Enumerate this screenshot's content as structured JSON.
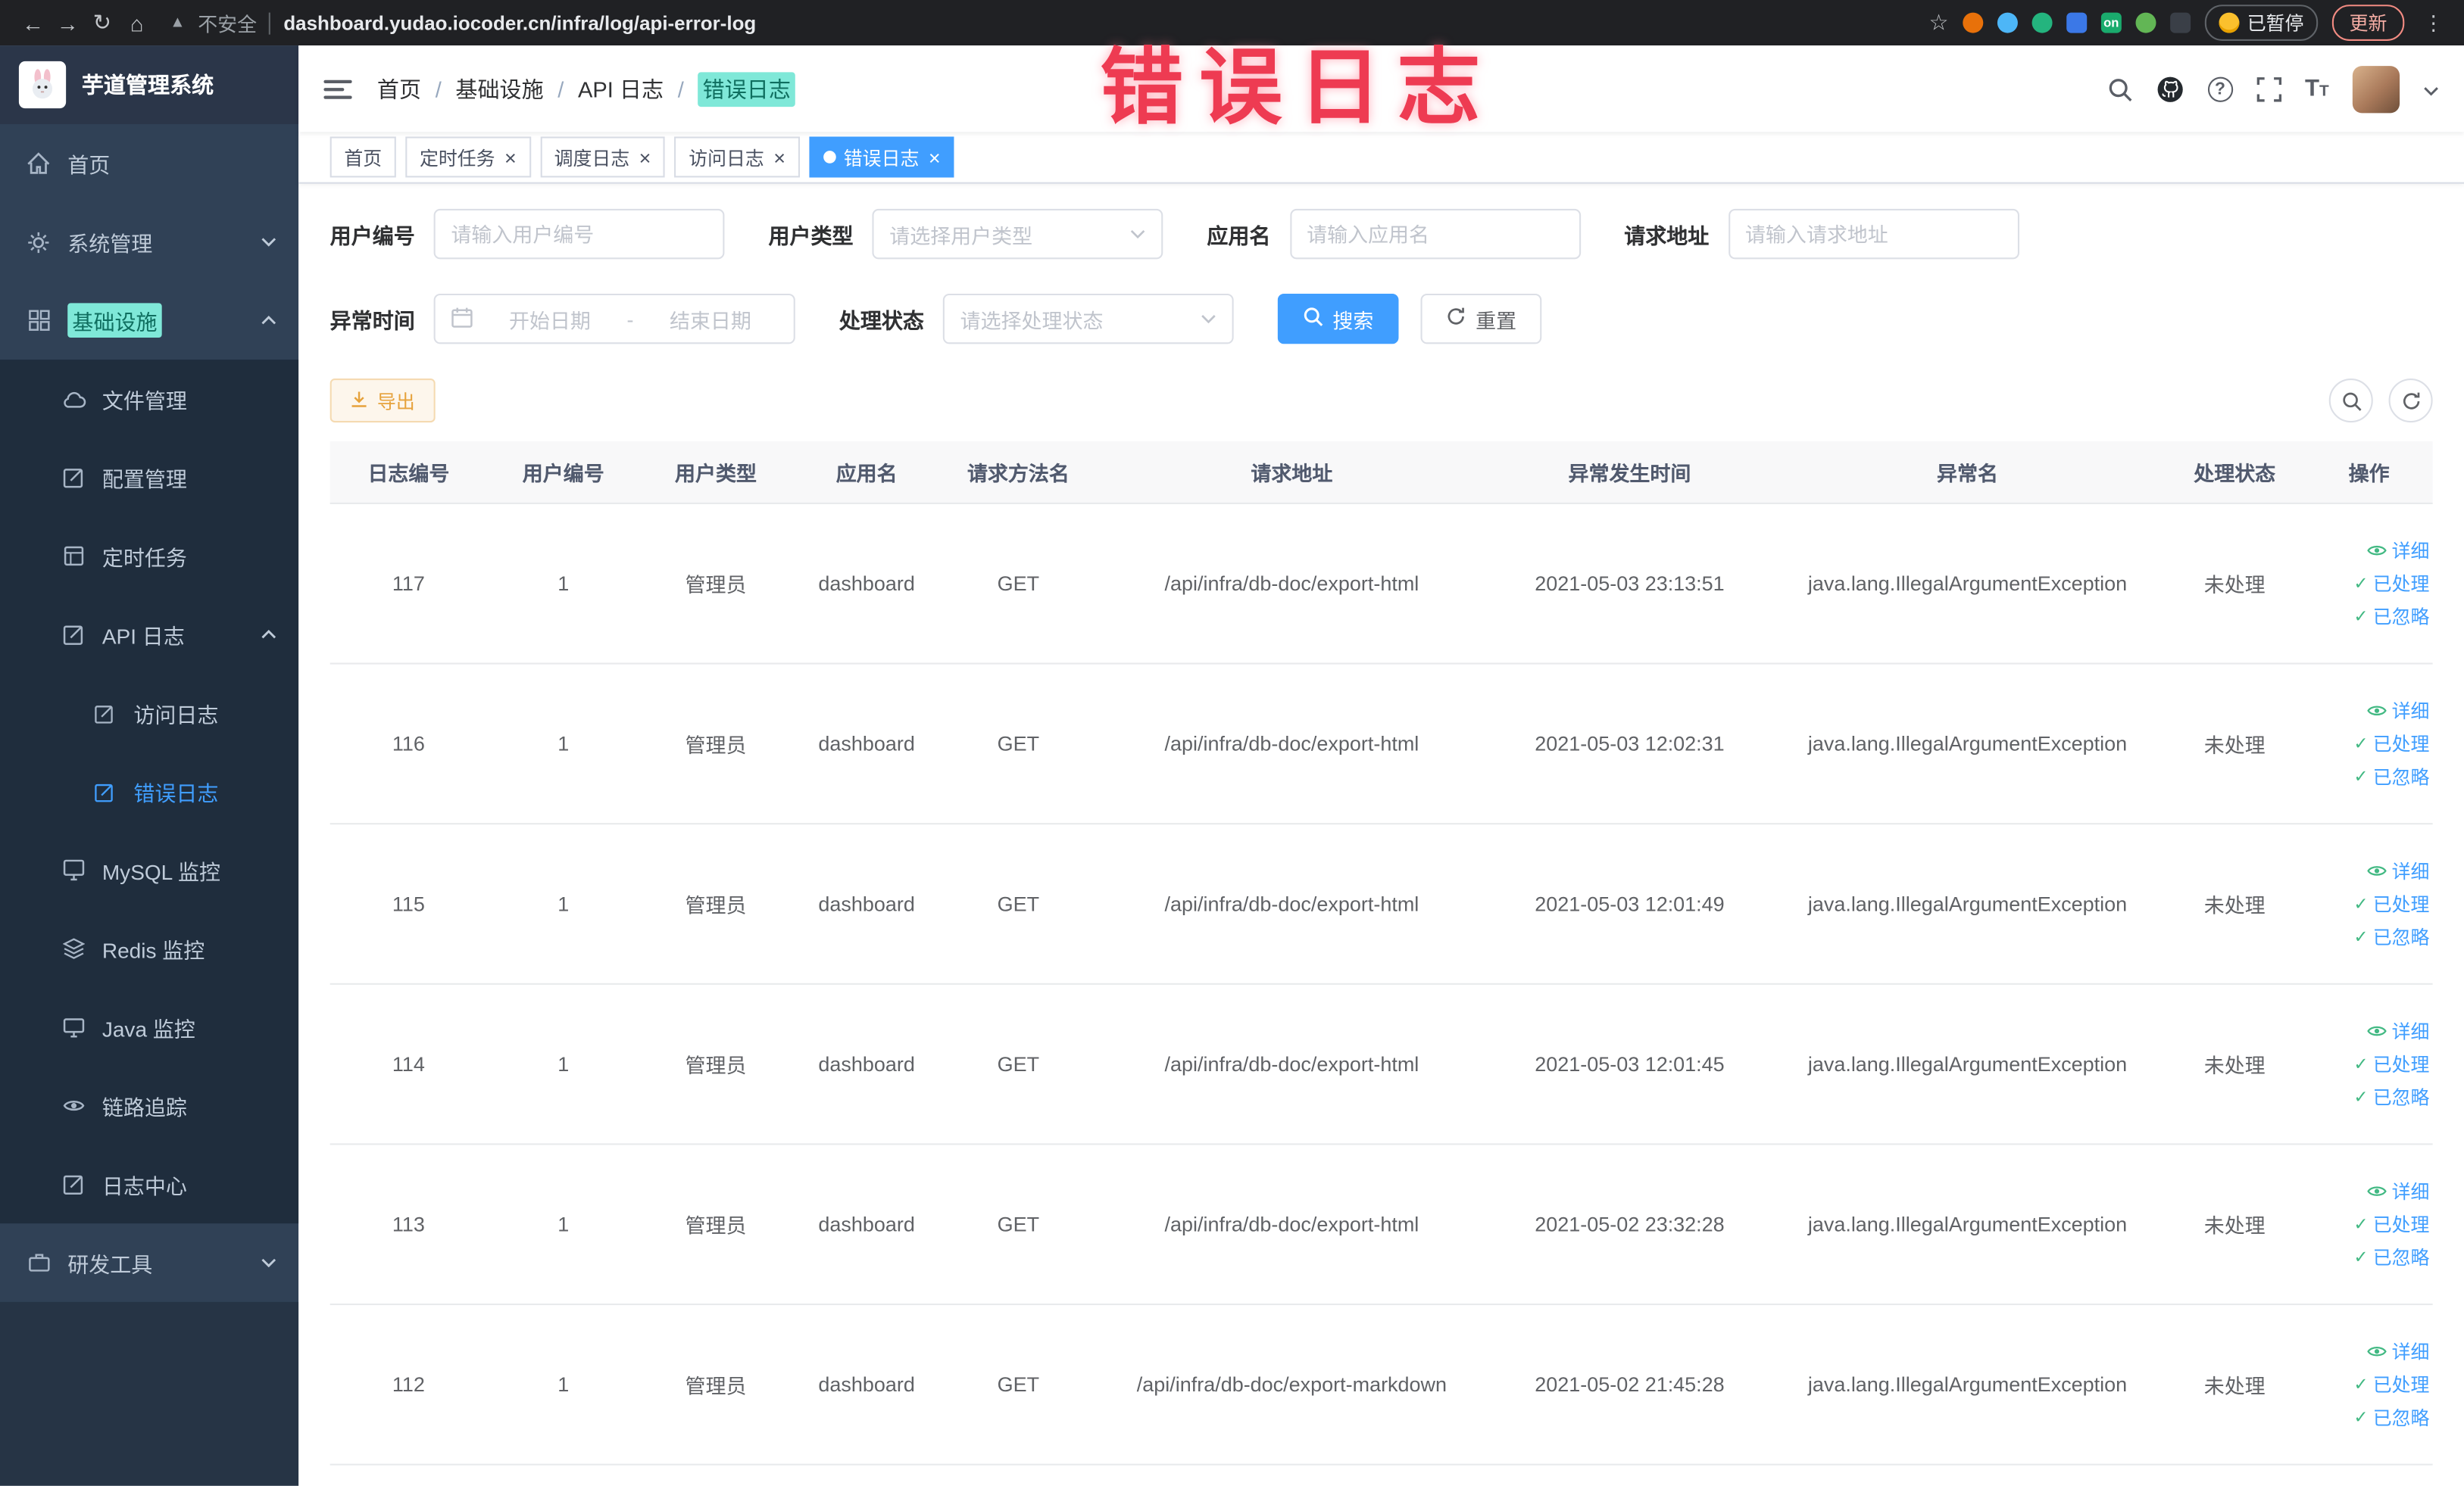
{
  "annotation": {
    "title": "错误日志"
  },
  "browser": {
    "security": "不安全",
    "url": "dashboard.yudao.iocoder.cn/infra/log/api-error-log",
    "paused": "已暂停",
    "update": "更新"
  },
  "sidebar": {
    "logo": "芋道管理系统",
    "items": {
      "home": "首页",
      "system": "系统管理",
      "infra": "基础设施",
      "file": "文件管理",
      "config": "配置管理",
      "job": "定时任务",
      "api_log": "API 日志",
      "access_log": "访问日志",
      "error_log": "错误日志",
      "mysql": "MySQL 监控",
      "redis": "Redis 监控",
      "java": "Java 监控",
      "trace": "链路追踪",
      "log_center": "日志中心",
      "dev_tools": "研发工具"
    }
  },
  "breadcrumb": {
    "separator": "/",
    "items": [
      "首页",
      "基础设施",
      "API 日志",
      "错误日志"
    ]
  },
  "tabs": [
    {
      "label": "首页"
    },
    {
      "label": "定时任务"
    },
    {
      "label": "调度日志"
    },
    {
      "label": "访问日志"
    },
    {
      "label": "错误日志"
    }
  ],
  "filters": {
    "user_id": {
      "label": "用户编号",
      "placeholder": "请输入用户编号"
    },
    "user_type": {
      "label": "用户类型",
      "placeholder": "请选择用户类型"
    },
    "app_name": {
      "label": "应用名",
      "placeholder": "请输入应用名"
    },
    "request_url": {
      "label": "请求地址",
      "placeholder": "请输入请求地址"
    },
    "exception_time": {
      "label": "异常时间",
      "start_placeholder": "开始日期",
      "separator": "-",
      "end_placeholder": "结束日期"
    },
    "process_status": {
      "label": "处理状态",
      "placeholder": "请选择处理状态"
    },
    "search_button": "搜索",
    "reset_button": "重置"
  },
  "toolbar": {
    "export": "导出"
  },
  "table": {
    "columns": [
      "日志编号",
      "用户编号",
      "用户类型",
      "应用名",
      "请求方法名",
      "请求地址",
      "异常发生时间",
      "异常名",
      "处理状态",
      "操作"
    ],
    "actions": {
      "detail": "详细",
      "processed": "已处理",
      "ignored": "已忽略"
    },
    "rows": [
      {
        "id": "117",
        "user_id": "1",
        "user_type": "管理员",
        "app": "dashboard",
        "method": "GET",
        "url": "/api/infra/db-doc/export-html",
        "time": "2021-05-03 23:13:51",
        "exception": "java.lang.IllegalArgumentException",
        "status": "未处理"
      },
      {
        "id": "116",
        "user_id": "1",
        "user_type": "管理员",
        "app": "dashboard",
        "method": "GET",
        "url": "/api/infra/db-doc/export-html",
        "time": "2021-05-03 12:02:31",
        "exception": "java.lang.IllegalArgumentException",
        "status": "未处理"
      },
      {
        "id": "115",
        "user_id": "1",
        "user_type": "管理员",
        "app": "dashboard",
        "method": "GET",
        "url": "/api/infra/db-doc/export-html",
        "time": "2021-05-03 12:01:49",
        "exception": "java.lang.IllegalArgumentException",
        "status": "未处理"
      },
      {
        "id": "114",
        "user_id": "1",
        "user_type": "管理员",
        "app": "dashboard",
        "method": "GET",
        "url": "/api/infra/db-doc/export-html",
        "time": "2021-05-03 12:01:45",
        "exception": "java.lang.IllegalArgumentException",
        "status": "未处理"
      },
      {
        "id": "113",
        "user_id": "1",
        "user_type": "管理员",
        "app": "dashboard",
        "method": "GET",
        "url": "/api/infra/db-doc/export-html",
        "time": "2021-05-02 23:32:28",
        "exception": "java.lang.IllegalArgumentException",
        "status": "未处理"
      },
      {
        "id": "112",
        "user_id": "1",
        "user_type": "管理员",
        "app": "dashboard",
        "method": "GET",
        "url": "/api/infra/db-doc/export-markdown",
        "time": "2021-05-02 21:45:28",
        "exception": "java.lang.IllegalArgumentException",
        "status": "未处理"
      }
    ]
  }
}
